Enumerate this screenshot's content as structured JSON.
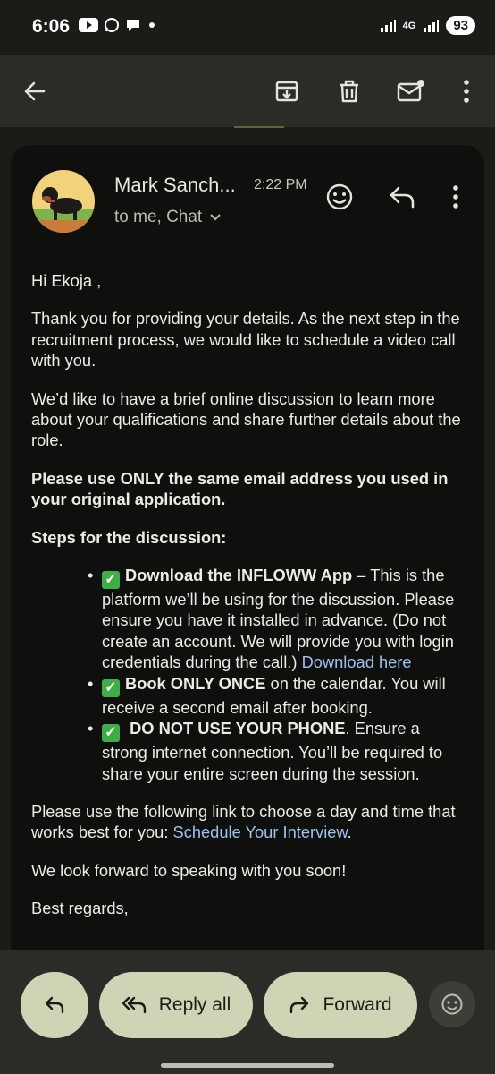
{
  "status": {
    "time": "6:06",
    "network": "4G",
    "battery": "93"
  },
  "email": {
    "sender": "Mark Sanch...",
    "time": "2:22 PM",
    "recipients": "to me, Chat",
    "greeting": "Hi Ekoja ,",
    "para1": "Thank you for providing your details. As the next step in the recruitment process, we would like to schedule a video call with you.",
    "para2": "We’d like to have a brief online discussion to learn more about your qualifications and share further details about the role.",
    "para3": "Please use ONLY the same email address you used in your original application.",
    "steps_heading": "Steps for the discussion:",
    "steps": [
      {
        "bold": "Download the INFLOWW App",
        "text": " – This is the platform we’ll be using for the discussion. Please ensure you have it installed in advance. (Do not create an account. We will provide you with login credentials during the call.) ",
        "link": "Download here"
      },
      {
        "bold": "Book ONLY ONCE",
        "text": " on the calendar. You will receive a second email after booking."
      },
      {
        "bold": " DO NOT USE YOUR PHONE",
        "text": ". Ensure a strong internet connection. You’ll be required to share your entire screen during the session."
      }
    ],
    "para4_text": "Please use the following link to choose a day and time that works best for you: ",
    "para4_link": "Schedule Your Interview",
    "para4_end": ".",
    "para5": "We look forward to speaking with you soon!",
    "closing": "Best regards,"
  },
  "actions": {
    "reply_all": "Reply all",
    "forward": "Forward"
  },
  "icons": {
    "back": "back-arrow-icon",
    "archive": "archive-icon",
    "delete": "trash-icon",
    "mark_unread": "mail-unread-icon",
    "more": "more-vert-icon",
    "emoji": "emoji-icon",
    "reply": "reply-icon",
    "check": "check-box-emoji"
  },
  "colors": {
    "accent_pill": "#cfd5b4",
    "link": "#9ec1f0",
    "check": "#3fae49"
  }
}
